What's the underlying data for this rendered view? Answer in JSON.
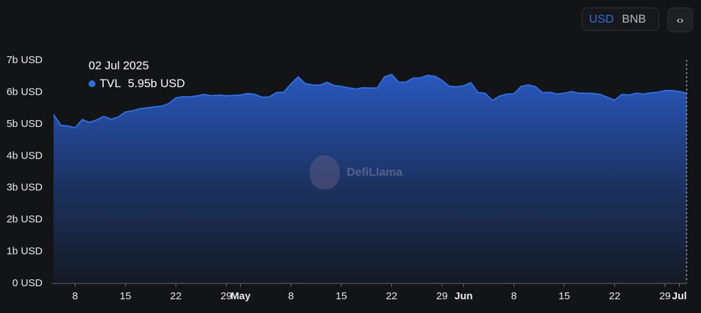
{
  "controls": {
    "usd_label": "USD",
    "bnb_label": "BNB",
    "active": "USD",
    "embed_icon": "code-icon"
  },
  "tooltip": {
    "date": "02 Jul 2025",
    "series_name": "TVL",
    "value_text": "5.95b USD"
  },
  "watermark": {
    "text": "DefiLlama"
  },
  "colors": {
    "background": "#131416",
    "line": "#2e6fe0",
    "area_top": "#2a5bc7",
    "area_bottom": "#151a25",
    "axis_text": "#e7e8ea"
  },
  "chart_data": {
    "type": "area",
    "x": [
      "2025-04-05",
      "2025-04-06",
      "2025-04-07",
      "2025-04-08",
      "2025-04-09",
      "2025-04-10",
      "2025-04-11",
      "2025-04-12",
      "2025-04-13",
      "2025-04-14",
      "2025-04-15",
      "2025-04-16",
      "2025-04-17",
      "2025-04-18",
      "2025-04-19",
      "2025-04-20",
      "2025-04-21",
      "2025-04-22",
      "2025-04-23",
      "2025-04-24",
      "2025-04-25",
      "2025-04-26",
      "2025-04-27",
      "2025-04-28",
      "2025-04-29",
      "2025-04-30",
      "2025-05-01",
      "2025-05-02",
      "2025-05-03",
      "2025-05-04",
      "2025-05-05",
      "2025-05-06",
      "2025-05-07",
      "2025-05-08",
      "2025-05-09",
      "2025-05-10",
      "2025-05-11",
      "2025-05-12",
      "2025-05-13",
      "2025-05-14",
      "2025-05-15",
      "2025-05-16",
      "2025-05-17",
      "2025-05-18",
      "2025-05-19",
      "2025-05-20",
      "2025-05-21",
      "2025-05-22",
      "2025-05-23",
      "2025-05-24",
      "2025-05-25",
      "2025-05-26",
      "2025-05-27",
      "2025-05-28",
      "2025-05-29",
      "2025-05-30",
      "2025-05-31",
      "2025-06-01",
      "2025-06-02",
      "2025-06-03",
      "2025-06-04",
      "2025-06-05",
      "2025-06-06",
      "2025-06-07",
      "2025-06-08",
      "2025-06-09",
      "2025-06-10",
      "2025-06-11",
      "2025-06-12",
      "2025-06-13",
      "2025-06-14",
      "2025-06-15",
      "2025-06-16",
      "2025-06-17",
      "2025-06-18",
      "2025-06-19",
      "2025-06-20",
      "2025-06-21",
      "2025-06-22",
      "2025-06-23",
      "2025-06-24",
      "2025-06-25",
      "2025-06-26",
      "2025-06-27",
      "2025-06-28",
      "2025-06-29",
      "2025-06-30",
      "2025-07-01",
      "2025-07-02"
    ],
    "series": [
      {
        "name": "TVL",
        "values": [
          5.28,
          4.94,
          4.92,
          4.86,
          5.12,
          5.03,
          5.11,
          5.22,
          5.13,
          5.2,
          5.36,
          5.4,
          5.46,
          5.49,
          5.52,
          5.54,
          5.62,
          5.8,
          5.84,
          5.83,
          5.87,
          5.91,
          5.87,
          5.89,
          5.87,
          5.88,
          5.89,
          5.94,
          5.91,
          5.82,
          5.83,
          5.97,
          5.98,
          6.24,
          6.46,
          6.25,
          6.21,
          6.2,
          6.29,
          6.19,
          6.16,
          6.12,
          6.08,
          6.12,
          6.11,
          6.11,
          6.46,
          6.54,
          6.29,
          6.3,
          6.42,
          6.43,
          6.51,
          6.48,
          6.35,
          6.17,
          6.15,
          6.18,
          6.28,
          5.97,
          5.95,
          5.72,
          5.86,
          5.92,
          5.93,
          6.16,
          6.21,
          6.15,
          5.96,
          5.98,
          5.92,
          5.95,
          6.0,
          5.95,
          5.95,
          5.94,
          5.91,
          5.82,
          5.73,
          5.91,
          5.89,
          5.95,
          5.92,
          5.96,
          5.98,
          6.03,
          6.03,
          6.0,
          5.95
        ]
      }
    ],
    "y_ticks": [
      "0 USD",
      "1b USD",
      "2b USD",
      "3b USD",
      "4b USD",
      "5b USD",
      "6b USD",
      "7b USD"
    ],
    "ylim": [
      0,
      7
    ],
    "x_ticks": [
      {
        "date": "2025-04-08",
        "label": "8",
        "bold": false
      },
      {
        "date": "2025-04-15",
        "label": "15",
        "bold": false
      },
      {
        "date": "2025-04-22",
        "label": "22",
        "bold": false
      },
      {
        "date": "2025-04-29",
        "label": "29",
        "bold": false
      },
      {
        "date": "2025-05-01",
        "label": "May",
        "bold": true
      },
      {
        "date": "2025-05-08",
        "label": "8",
        "bold": false
      },
      {
        "date": "2025-05-15",
        "label": "15",
        "bold": false
      },
      {
        "date": "2025-05-22",
        "label": "22",
        "bold": false
      },
      {
        "date": "2025-05-29",
        "label": "29",
        "bold": false
      },
      {
        "date": "2025-06-01",
        "label": "Jun",
        "bold": true
      },
      {
        "date": "2025-06-08",
        "label": "8",
        "bold": false
      },
      {
        "date": "2025-06-15",
        "label": "15",
        "bold": false
      },
      {
        "date": "2025-06-22",
        "label": "22",
        "bold": false
      },
      {
        "date": "2025-06-29",
        "label": "29",
        "bold": false
      },
      {
        "date": "2025-07-01",
        "label": "Jul",
        "bold": true
      }
    ],
    "hover_date": "2025-07-02",
    "grid": false,
    "legend": "tooltip"
  }
}
